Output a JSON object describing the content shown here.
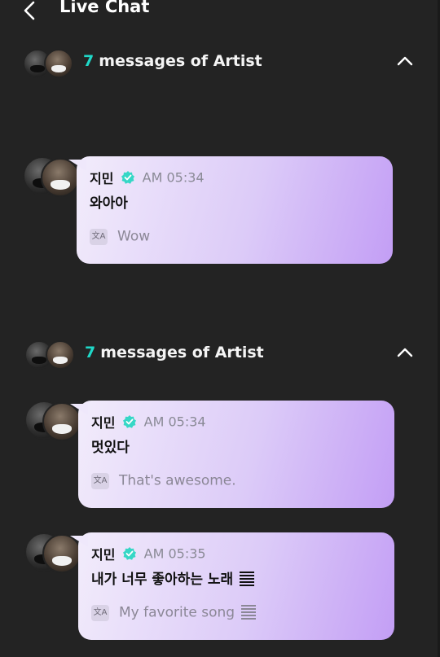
{
  "header": {
    "title": "Live Chat",
    "back_icon": "chevron-left-icon"
  },
  "groups": [
    {
      "count": "7",
      "label": "messages of Artist",
      "messages": [
        {
          "name": "지민",
          "time": "AM 05:34",
          "text": "와아아",
          "translation": "Wow"
        }
      ]
    },
    {
      "count": "7",
      "label": "messages of Artist",
      "messages": [
        {
          "name": "지민",
          "time": "AM 05:34",
          "text": "멋있다",
          "translation": "That's awesome."
        },
        {
          "name": "지민",
          "time": "AM 05:35",
          "text": "내가 너무 좋아하는 노래",
          "translation": "My favorite song"
        }
      ]
    }
  ],
  "icons": {
    "verified": "verified-badge-icon",
    "translate": "translate-icon",
    "collapse": "chevron-up-icon",
    "translate_glyph": "文A"
  },
  "colors": {
    "accent_count": "#1fd8c8",
    "bubble_start": "#f2ecfb",
    "bubble_end": "#c39ef5",
    "verified": "#36d7c6",
    "background": "#232323"
  }
}
